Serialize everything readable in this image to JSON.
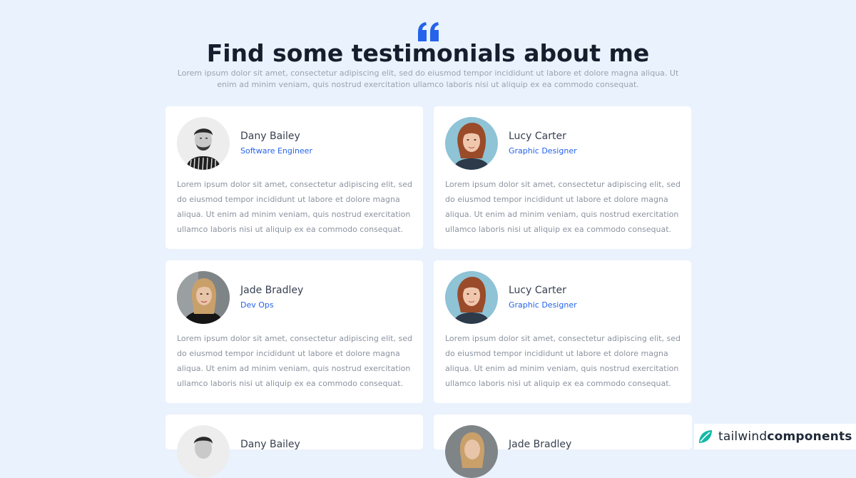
{
  "header": {
    "quote_icon": "quote-icon",
    "title": "Find some testimonials about me",
    "subtitle": "Lorem ipsum dolor sit amet, consectetur adipiscing elit, sed do eiusmod tempor incididunt ut labore et dolore magna aliqua. Ut enim ad minim veniam, quis nostrud exercitation ullamco laboris nisi ut aliquip ex ea commodo consequat."
  },
  "testimonials": [
    {
      "name": "Dany Bailey",
      "role": "Software Engineer",
      "text": "Lorem ipsum dolor sit amet, consectetur adipiscing elit, sed do eiusmod tempor incididunt ut labore et dolore magna aliqua. Ut enim ad minim veniam, quis nostrud exercitation ullamco laboris nisi ut aliquip ex ea commodo consequat."
    },
    {
      "name": "Lucy Carter",
      "role": "Graphic Designer",
      "text": "Lorem ipsum dolor sit amet, consectetur adipiscing elit, sed do eiusmod tempor incididunt ut labore et dolore magna aliqua. Ut enim ad minim veniam, quis nostrud exercitation ullamco laboris nisi ut aliquip ex ea commodo consequat."
    },
    {
      "name": "Jade Bradley",
      "role": "Dev Ops",
      "text": "Lorem ipsum dolor sit amet, consectetur adipiscing elit, sed do eiusmod tempor incididunt ut labore et dolore magna aliqua. Ut enim ad minim veniam, quis nostrud exercitation ullamco laboris nisi ut aliquip ex ea commodo consequat."
    },
    {
      "name": "Lucy Carter",
      "role": "Graphic Designer",
      "text": "Lorem ipsum dolor sit amet, consectetur adipiscing elit, sed do eiusmod tempor incididunt ut labore et dolore magna aliqua. Ut enim ad minim veniam, quis nostrud exercitation ullamco laboris nisi ut aliquip ex ea commodo consequat."
    },
    {
      "name": "Dany Bailey",
      "role": "",
      "text": ""
    },
    {
      "name": "Jade Bradley",
      "role": "",
      "text": ""
    }
  ],
  "badge": {
    "brand_light": "tailwind",
    "brand_bold": "components",
    "logo_icon": "tailwind-leaf-icon"
  },
  "colors": {
    "background": "#eaf2fd",
    "accent": "#2563eb",
    "title": "#161e2e",
    "muted": "#9ca3af"
  }
}
